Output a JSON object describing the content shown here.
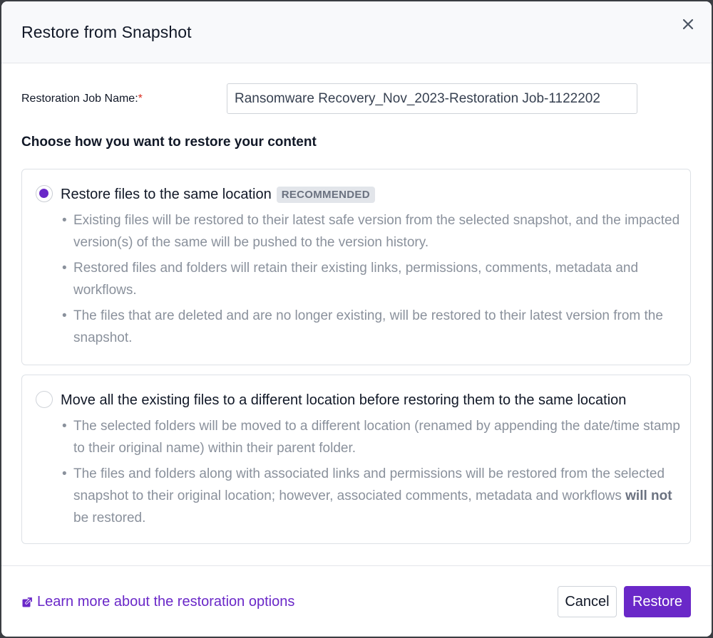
{
  "modal": {
    "title": "Restore from Snapshot",
    "close_icon": "close-icon"
  },
  "form": {
    "job_name_label": "Restoration Job Name:",
    "required_marker": "*",
    "job_name_value": "Ransomware Recovery_Nov_2023-Restoration Job-1122202",
    "section_heading": "Choose how you want to restore your content"
  },
  "options": [
    {
      "title": "Restore files to the same location",
      "badge": "RECOMMENDED",
      "selected": true,
      "bullets": [
        "Existing files will be restored to their latest safe version from the selected snapshot, and the impacted version(s) of the same will be pushed to the version history.",
        "Restored files and folders will retain their existing links, permissions, comments, metadata and workflows.",
        "The files that are deleted and are no longer existing, will be restored to their latest version from the snapshot."
      ]
    },
    {
      "title": "Move all the existing files to a different location before restoring them to the same location",
      "selected": false,
      "bullets": [
        "The selected folders will be moved to a different location (renamed by appending the date/time stamp to their original name) within their parent folder."
      ],
      "bullet_last_prefix": "The files and folders along with associated links and permissions will be restored from the selected snapshot to their original location; however, associated comments, metadata and workflows ",
      "bullet_last_bold": "will not",
      "bullet_last_suffix": " be restored."
    }
  ],
  "footer": {
    "learn_more": "Learn more about the restoration options",
    "learn_icon": "external-link-icon",
    "cancel_label": "Cancel",
    "restore_label": "Restore"
  },
  "colors": {
    "accent": "#6a28c8",
    "required": "#d92d20",
    "muted_text": "#8a919c"
  }
}
